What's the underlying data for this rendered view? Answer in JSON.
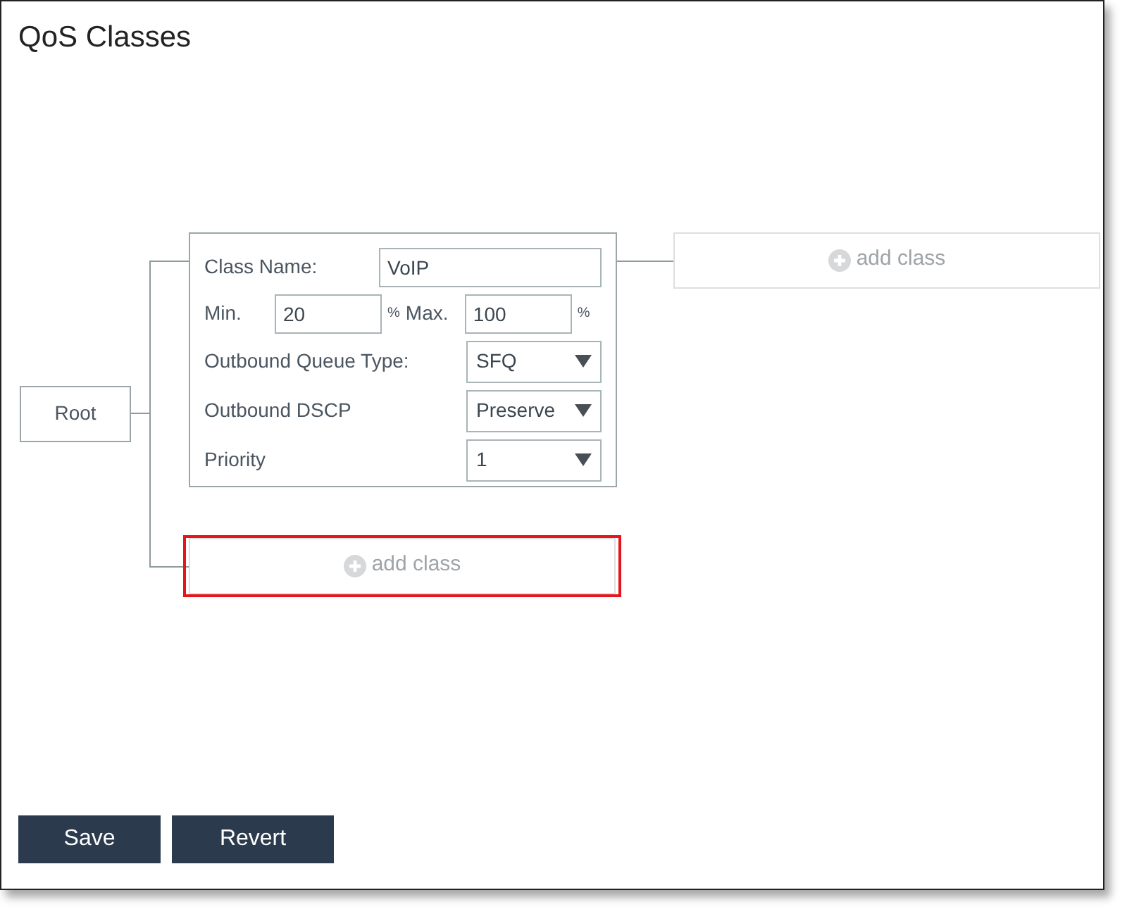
{
  "title": "QoS Classes",
  "tree": {
    "root": {
      "label": "Root"
    },
    "class_card": {
      "class_name_label": "Class Name:",
      "class_name": "VoIP",
      "min_label": "Min.",
      "min": "20",
      "min_unit": "%",
      "max_label": "Max.",
      "max": "100",
      "max_unit": "%",
      "selects": [
        {
          "label": "Outbound Queue Type:",
          "value": "SFQ"
        },
        {
          "label": "Outbound DSCP",
          "value": "Preserve"
        },
        {
          "label": "Priority",
          "value": "1"
        }
      ]
    },
    "add_class_slots": [
      {
        "label": "add class",
        "highlighted": false
      },
      {
        "label": "add class",
        "highlighted": true
      }
    ]
  },
  "buttons": [
    "Save",
    "Revert"
  ]
}
